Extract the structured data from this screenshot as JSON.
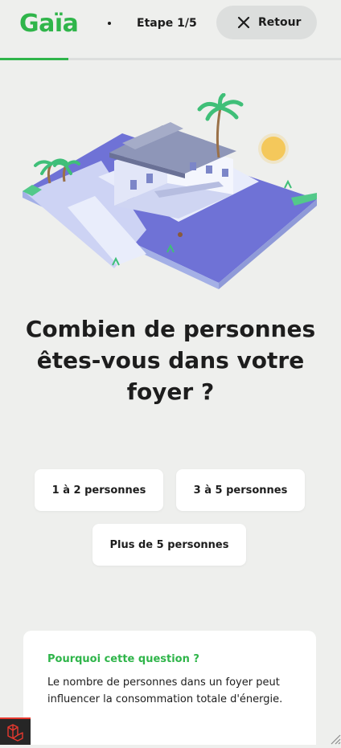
{
  "header": {
    "logo_text": "Gaïa",
    "step_text": "Etape 1/5",
    "back_label": "Retour",
    "progress_fraction": 0.2
  },
  "question": {
    "title": "Combien de personnes êtes-vous dans votre foyer ?"
  },
  "options": [
    {
      "label": "1 à 2 personnes"
    },
    {
      "label": "3 à 5 personnes"
    },
    {
      "label": "Plus de 5 personnes"
    }
  ],
  "info": {
    "title": "Pourquoi cette question ?",
    "text": "Le nombre de personnes dans un foyer peut influencer la consommation totale d'énergie."
  },
  "colors": {
    "brand_green": "#2fb54a",
    "background": "#eeefed",
    "card": "#ffffff"
  },
  "icons": [
    "close-icon",
    "laravel-icon",
    "resize-handle-icon"
  ]
}
